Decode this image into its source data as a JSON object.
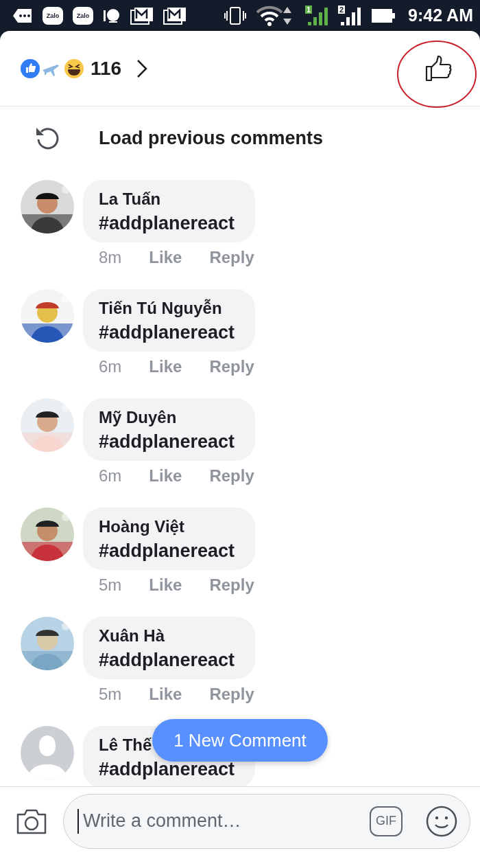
{
  "status_bar": {
    "notifications": [
      {
        "kind": "more"
      },
      {
        "kind": "zalo",
        "label": "Zalo"
      },
      {
        "kind": "zalo",
        "label": "Zalo"
      },
      {
        "kind": "messenger"
      },
      {
        "kind": "mail"
      },
      {
        "kind": "mail"
      }
    ],
    "sim_1": "1",
    "sim_2": "2",
    "time": "9:42 AM"
  },
  "reactions": {
    "count": "116"
  },
  "load_previous": "Load previous comments",
  "comments": [
    {
      "name": "La Tuấn",
      "text": "#addplanereact",
      "time": "8m",
      "like": "Like",
      "reply": "Reply",
      "kind": "picture"
    },
    {
      "name": "Tiến Tú Nguyễn",
      "text": "#addplanereact",
      "time": "6m",
      "like": "Like",
      "reply": "Reply",
      "kind": "picture"
    },
    {
      "name": "Mỹ Duyên",
      "text": "#addplanereact",
      "time": "6m",
      "like": "Like",
      "reply": "Reply",
      "kind": "picture"
    },
    {
      "name": "Hoàng Việt",
      "text": "#addplanereact",
      "time": "5m",
      "like": "Like",
      "reply": "Reply",
      "kind": "picture"
    },
    {
      "name": "Xuân Hà",
      "text": "#addplanereact",
      "time": "5m",
      "like": "Like",
      "reply": "Reply",
      "kind": "picture"
    },
    {
      "name": "Lê Thế",
      "text": "#addplanereact",
      "kind": "default"
    }
  ],
  "new_comment_button": "1 New Comment",
  "composer": {
    "placeholder": "Write a comment…",
    "gif": "GIF"
  }
}
